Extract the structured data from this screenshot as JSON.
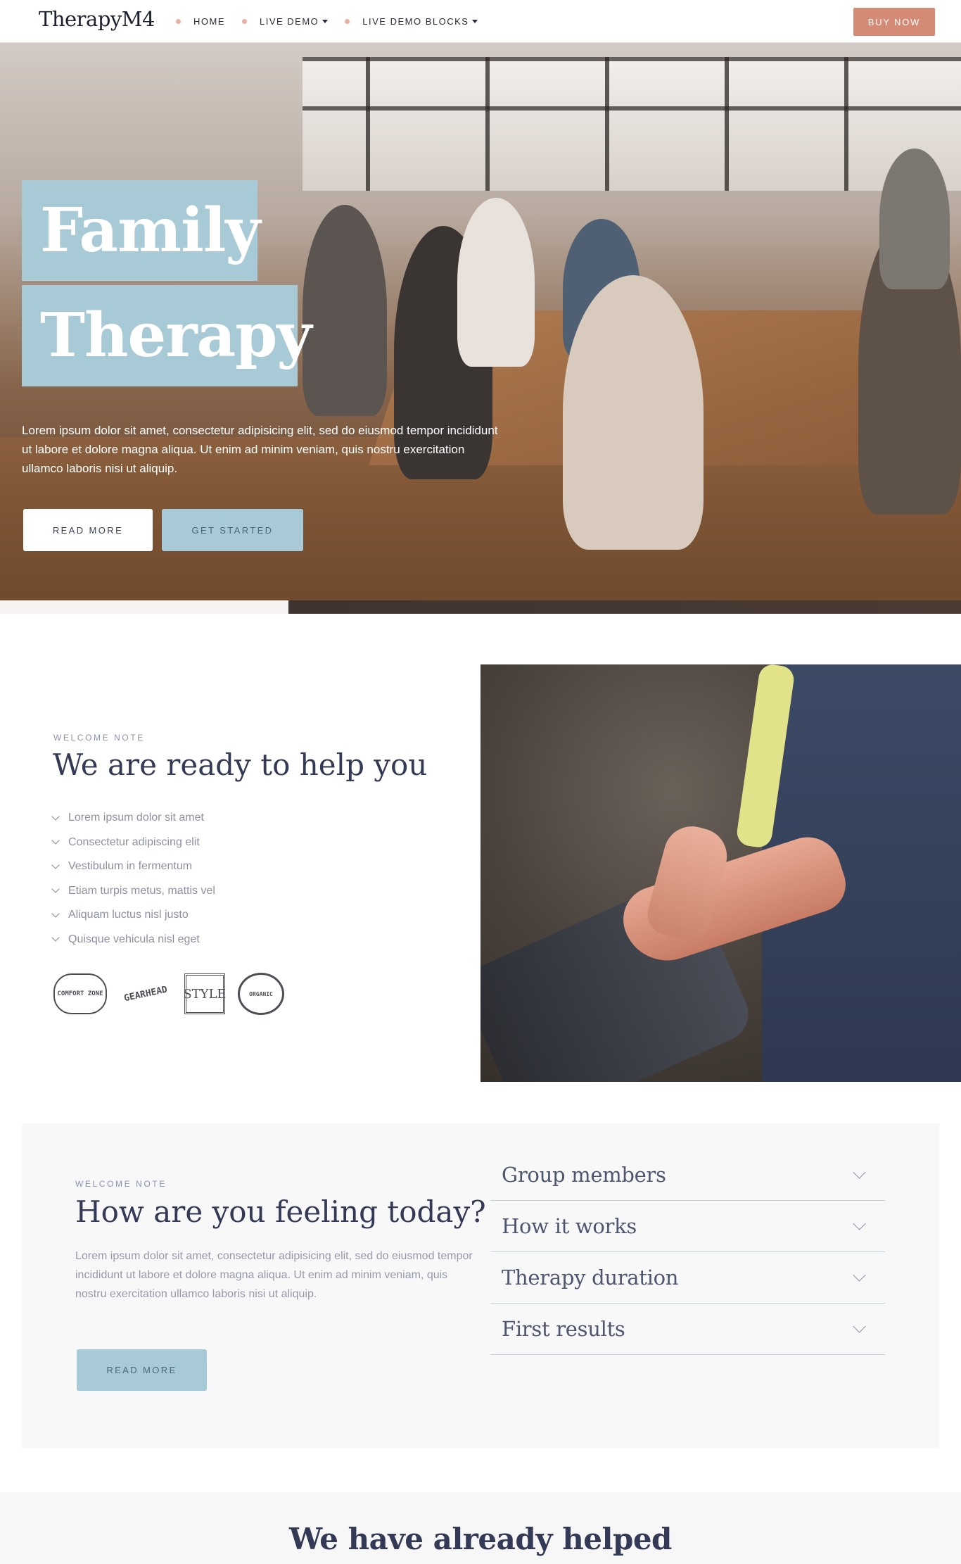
{
  "navbar": {
    "brand": "TherapyM4",
    "items": [
      {
        "label": "HOME",
        "dropdown": false
      },
      {
        "label": "LIVE DEMO",
        "dropdown": true
      },
      {
        "label": "LIVE DEMO BLOCKS",
        "dropdown": true
      }
    ],
    "buy_label": "BUY NOW"
  },
  "hero": {
    "title_line1": "Family",
    "title_line2": "Therapy",
    "text": "Lorem ipsum dolor sit amet, consectetur adipisicing elit, sed do eiusmod tempor incididunt ut labore et dolore magna aliqua. Ut enim ad minim veniam, quis nostru exercitation ullamco laboris nisi ut aliquip.",
    "read_more": "READ MORE",
    "get_started": "GET STARTED"
  },
  "welcome": {
    "eyebrow": "WELCOME NOTE",
    "title": "We are ready to help you",
    "list": [
      "Lorem ipsum dolor sit amet",
      "Consectetur adipiscing elit",
      "Vestibulum in fermentum",
      "Etiam turpis metus, mattis vel",
      "Aliquam luctus nisl justo",
      "Quisque vehicula nisl eget"
    ],
    "logos": [
      "COMFORT ZONE",
      "GEARHEAD",
      "STYLE",
      "ORGANIC"
    ]
  },
  "feeling": {
    "eyebrow": "WELCOME NOTE",
    "title": "How are you feeling today?",
    "text": "Lorem ipsum dolor sit amet, consectetur adipisicing elit, sed do eiusmod tempor incididunt ut labore et dolore magna aliqua. Ut enim ad minim veniam, quis nostru exercitation ullamco laboris nisi ut aliquip.",
    "read_more": "READ MORE",
    "accordion": [
      "Group members",
      "How it works",
      "Therapy duration",
      "First results"
    ]
  },
  "helped": {
    "title": "We have already helped"
  },
  "colors": {
    "accent_blue": "#a8c9d6",
    "buy_button": "#d58a76",
    "nav_dot": "#eaaea3",
    "heading": "#343a55"
  }
}
